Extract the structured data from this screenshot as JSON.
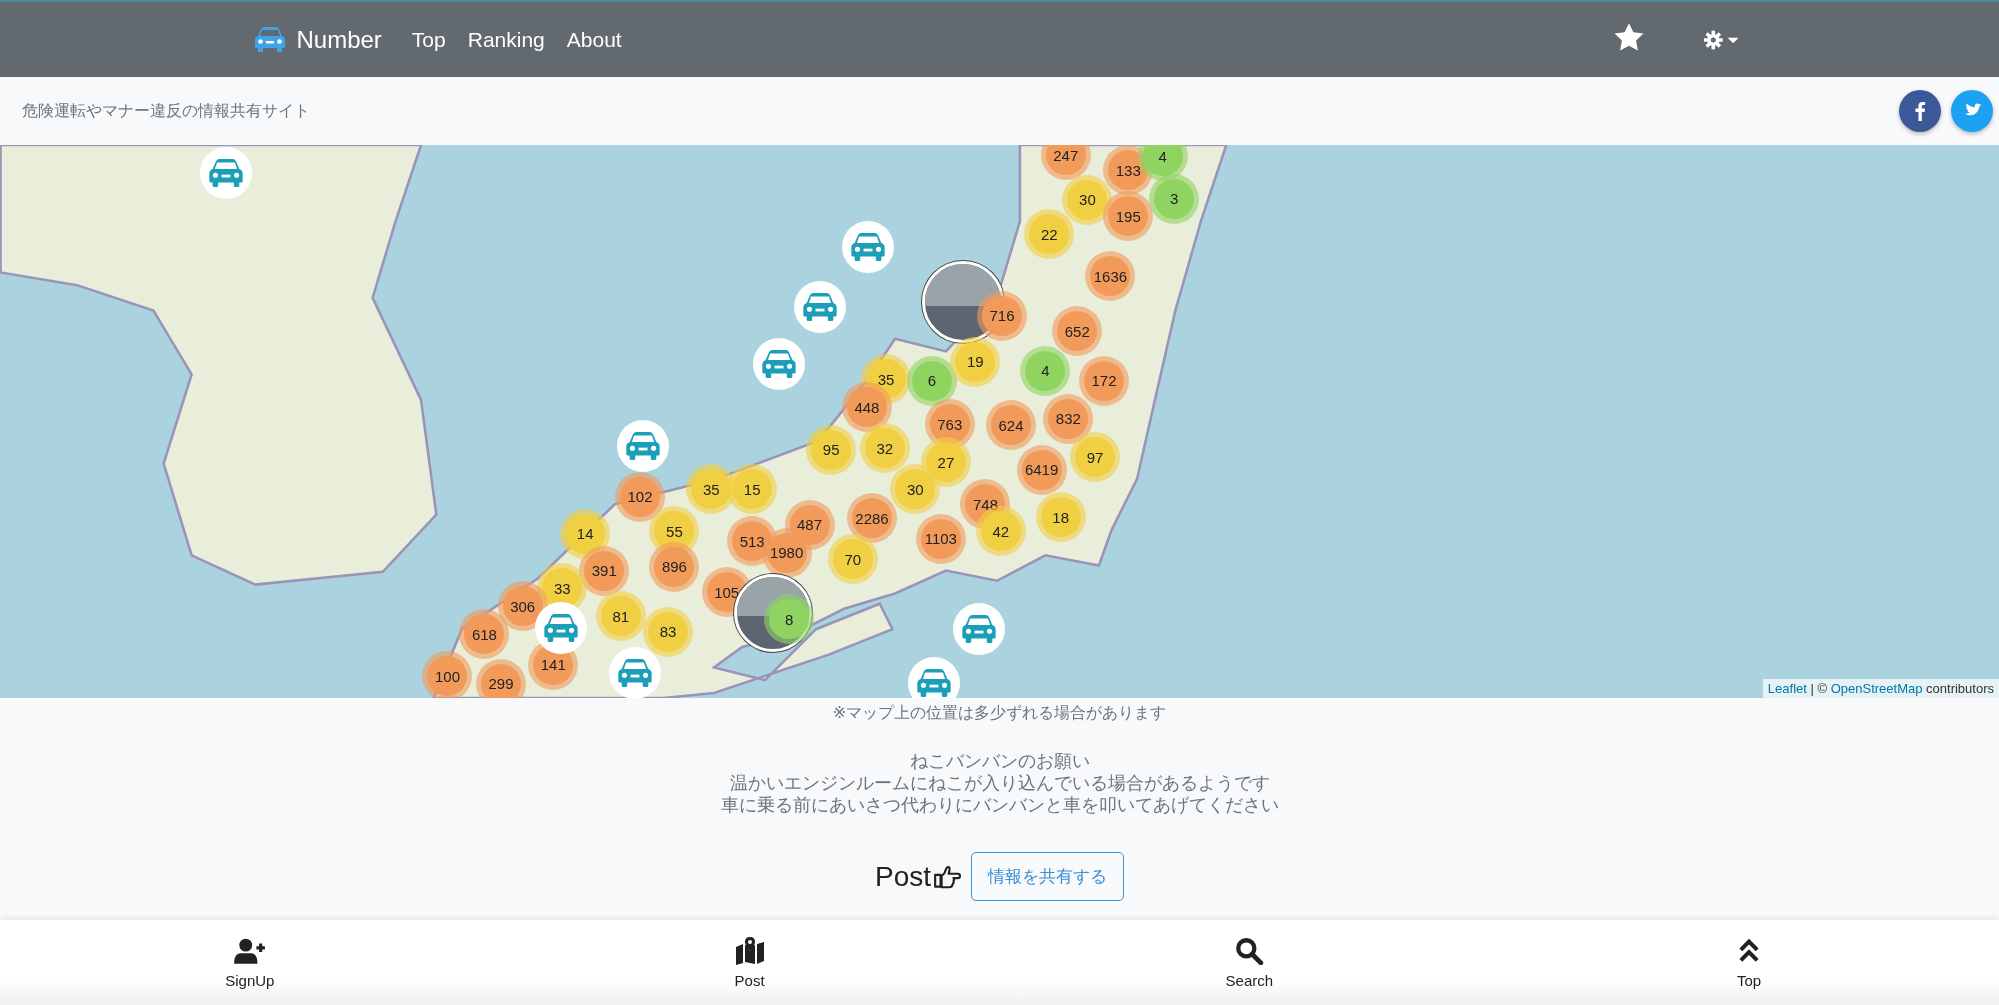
{
  "navbar": {
    "brand": "Number",
    "links": [
      {
        "label": "Top"
      },
      {
        "label": "Ranking"
      },
      {
        "label": "About"
      }
    ]
  },
  "subbar": {
    "tagline": "危険運転やマナー違反の情報共有サイト"
  },
  "map": {
    "markers": [
      {
        "kind": "car"
      },
      {
        "kind": "car"
      },
      {
        "kind": "car"
      },
      {
        "kind": "car"
      },
      {
        "kind": "car"
      },
      {
        "kind": "photo"
      },
      {
        "kind": "cluster",
        "count": "247",
        "color": "#f29a5a"
      },
      {
        "kind": "cluster",
        "count": "133",
        "color": "#f29a5a"
      },
      {
        "kind": "cluster",
        "count": "4",
        "color": "#8fd461"
      },
      {
        "kind": "cluster",
        "count": "30",
        "color": "#f1cf43"
      },
      {
        "kind": "cluster",
        "count": "195",
        "color": "#f29a5a"
      },
      {
        "kind": "cluster",
        "count": "3",
        "color": "#8fd461"
      },
      {
        "kind": "cluster",
        "count": "22",
        "color": "#f1cf43"
      },
      {
        "kind": "cluster",
        "count": "1636",
        "color": "#f29a5a"
      },
      {
        "kind": "cluster",
        "count": "716",
        "color": "#f29a5a"
      },
      {
        "kind": "cluster",
        "count": "652",
        "color": "#f29a5a"
      },
      {
        "kind": "cluster",
        "count": "35",
        "color": "#f1cf43"
      },
      {
        "kind": "cluster",
        "count": "6",
        "color": "#8fd461"
      },
      {
        "kind": "cluster",
        "count": "19",
        "color": "#f1cf43"
      },
      {
        "kind": "cluster",
        "count": "4",
        "color": "#8fd461"
      },
      {
        "kind": "cluster",
        "count": "172",
        "color": "#f29a5a"
      },
      {
        "kind": "cluster",
        "count": "448",
        "color": "#f29a5a"
      },
      {
        "kind": "cluster",
        "count": "763",
        "color": "#f29a5a"
      },
      {
        "kind": "cluster",
        "count": "624",
        "color": "#f29a5a"
      },
      {
        "kind": "cluster",
        "count": "832",
        "color": "#f29a5a"
      },
      {
        "kind": "cluster",
        "count": "95",
        "color": "#f1cf43"
      },
      {
        "kind": "cluster",
        "count": "32",
        "color": "#f1cf43"
      },
      {
        "kind": "cluster",
        "count": "27",
        "color": "#f1cf43"
      },
      {
        "kind": "cluster",
        "count": "97",
        "color": "#f1cf43"
      },
      {
        "kind": "cluster",
        "count": "6419",
        "color": "#f29a5a"
      },
      {
        "kind": "cluster",
        "count": "102",
        "color": "#f29a5a"
      },
      {
        "kind": "cluster",
        "count": "35",
        "color": "#f1cf43"
      },
      {
        "kind": "cluster",
        "count": "15",
        "color": "#f1cf43"
      },
      {
        "kind": "cluster",
        "count": "30",
        "color": "#f1cf43"
      },
      {
        "kind": "cluster",
        "count": "748",
        "color": "#f29a5a"
      },
      {
        "kind": "cluster",
        "count": "14",
        "color": "#f1cf43"
      },
      {
        "kind": "cluster",
        "count": "55",
        "color": "#f1cf43"
      },
      {
        "kind": "cluster",
        "count": "487",
        "color": "#f29a5a"
      },
      {
        "kind": "cluster",
        "count": "2286",
        "color": "#f29a5a"
      },
      {
        "kind": "cluster",
        "count": "1103",
        "color": "#f29a5a"
      },
      {
        "kind": "cluster",
        "count": "42",
        "color": "#f1cf43"
      },
      {
        "kind": "cluster",
        "count": "18",
        "color": "#f1cf43"
      },
      {
        "kind": "cluster",
        "count": "513",
        "color": "#f29a5a"
      },
      {
        "kind": "cluster",
        "count": "1980",
        "color": "#f29a5a"
      },
      {
        "kind": "cluster",
        "count": "70",
        "color": "#f1cf43"
      },
      {
        "kind": "cluster",
        "count": "391",
        "color": "#f29a5a"
      },
      {
        "kind": "cluster",
        "count": "896",
        "color": "#f29a5a"
      },
      {
        "kind": "cluster",
        "count": "33",
        "color": "#f1cf43"
      },
      {
        "kind": "cluster",
        "count": "105",
        "color": "#f29a5a"
      },
      {
        "kind": "photo"
      },
      {
        "kind": "cluster",
        "count": "8",
        "color": "#8fd461"
      },
      {
        "kind": "cluster",
        "count": "306",
        "color": "#f29a5a"
      },
      {
        "kind": "cluster",
        "count": "81",
        "color": "#f1cf43"
      },
      {
        "kind": "cluster",
        "count": "83",
        "color": "#f1cf43"
      },
      {
        "kind": "cluster",
        "count": "618",
        "color": "#f29a5a"
      },
      {
        "kind": "cluster",
        "count": "141",
        "color": "#f29a5a"
      },
      {
        "kind": "cluster",
        "count": "100",
        "color": "#f29a5a"
      },
      {
        "kind": "cluster",
        "count": "299",
        "color": "#f29a5a"
      },
      {
        "kind": "car"
      },
      {
        "kind": "car"
      },
      {
        "kind": "car"
      },
      {
        "kind": "car"
      }
    ],
    "attribution": {
      "leaflet_link": "Leaflet",
      "separator": "| ©",
      "osm_link": "OpenStreetMap",
      "suffix": "contributors"
    }
  },
  "position_note": "※マップ上の位置は多少ずれる場合があります",
  "notice": {
    "title": "ねこバンバンのお願い",
    "lines": [
      "温かいエンジンルームにねこが入り込んでいる場合があるようです",
      "車に乗る前にあいさつ代わりにバンバンと車を叩いてあげてください"
    ]
  },
  "post": {
    "label": "Post",
    "button": "情報を共有する"
  },
  "bottom_nav": [
    {
      "kind": "signup",
      "label": "SignUp"
    },
    {
      "kind": "post",
      "label": "Post"
    },
    {
      "kind": "search",
      "label": "Search"
    },
    {
      "kind": "top",
      "label": "Top"
    }
  ]
}
